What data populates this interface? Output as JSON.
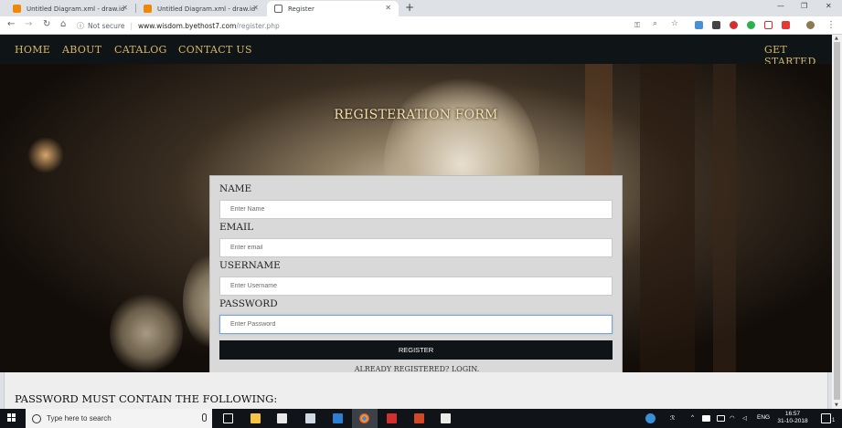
{
  "browser": {
    "tabs": [
      {
        "title": "Untitled Diagram.xml - draw.io",
        "favicon": "drawio-icon",
        "active": false
      },
      {
        "title": "Untitled Diagram.xml - draw.io",
        "favicon": "drawio-icon",
        "active": false
      },
      {
        "title": "Register",
        "favicon": "page-icon",
        "active": true
      }
    ],
    "new_tab": "+",
    "close_glyph": "✕",
    "window_controls": {
      "minimize": "—",
      "maximize": "❐",
      "close": "✕"
    },
    "address": {
      "security": "Not secure",
      "host": "www.wisdom.byethost7.com",
      "path": "/register.php"
    },
    "nav_icons": [
      "back-icon",
      "forward-icon",
      "reload-icon",
      "home-icon"
    ],
    "accent_colors": {
      "chrome_bg": "#dee1e6",
      "link_gold": "#d9b56a"
    }
  },
  "site": {
    "nav": {
      "links": [
        "Home",
        "About",
        "Catalog",
        "Contact Us"
      ],
      "cta": "Get Started"
    },
    "hero_title": "Registeration Form",
    "form": {
      "fields": [
        {
          "label": "Name",
          "placeholder": "Enter Name"
        },
        {
          "label": "Email",
          "placeholder": "Enter email"
        },
        {
          "label": "Username",
          "placeholder": "Enter Username"
        },
        {
          "label": "Password",
          "placeholder": "Enter Password"
        }
      ],
      "submit_label": "Register",
      "already_text": "Already registered?",
      "login_link": "Login."
    },
    "rules_title": "Password must contain the following:"
  },
  "taskbar": {
    "search_placeholder": "Type here to search",
    "tray_language": "ENG",
    "tray_caret": "^",
    "clock_time": "16:57",
    "clock_date": "31-10-2018",
    "notification_count": "1"
  }
}
